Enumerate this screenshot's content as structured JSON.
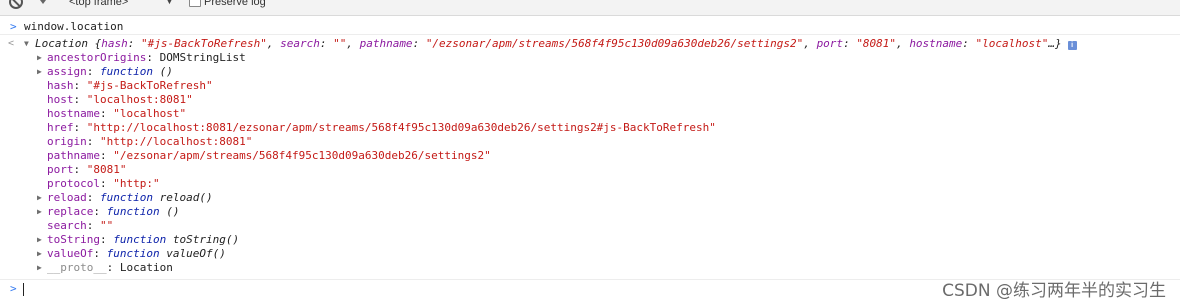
{
  "toolbar": {
    "clear_icon": "clear-console-icon",
    "filter_icon": "filter-icon",
    "context": "<top frame>",
    "context_caret": "▼",
    "preserve_log": "Preserve log"
  },
  "console": {
    "input_prompt": ">",
    "return_marker": "<",
    "command": "window.location",
    "result": {
      "class_name": "Location",
      "summary_open": " {",
      "summary": [
        {
          "key": "hash",
          "value": "\"#js-BackToRefresh\""
        },
        {
          "key": "search",
          "value": "\"\""
        },
        {
          "key": "pathname",
          "value": "\"/ezsonar/apm/streams/568f4f95c130d09a630deb26/settings2\""
        },
        {
          "key": "port",
          "value": "\"8081\""
        },
        {
          "key": "hostname",
          "value": "\"localhost\""
        }
      ],
      "summary_close": "…}",
      "info_icon": "i",
      "properties": [
        {
          "key": "ancestorOrigins",
          "value": "DOMStringList",
          "kind": "object",
          "expandable": true
        },
        {
          "key": "assign",
          "fn": "function",
          "value": " ()",
          "kind": "function",
          "expandable": true
        },
        {
          "key": "hash",
          "value": "\"#js-BackToRefresh\"",
          "kind": "string",
          "expandable": false
        },
        {
          "key": "host",
          "value": "\"localhost:8081\"",
          "kind": "string",
          "expandable": false
        },
        {
          "key": "hostname",
          "value": "\"localhost\"",
          "kind": "string",
          "expandable": false
        },
        {
          "key": "href",
          "value": "\"http://localhost:8081/ezsonar/apm/streams/568f4f95c130d09a630deb26/settings2#js-BackToRefresh\"",
          "kind": "string",
          "expandable": false
        },
        {
          "key": "origin",
          "value": "\"http://localhost:8081\"",
          "kind": "string",
          "expandable": false
        },
        {
          "key": "pathname",
          "value": "\"/ezsonar/apm/streams/568f4f95c130d09a630deb26/settings2\"",
          "kind": "string",
          "expandable": false
        },
        {
          "key": "port",
          "value": "\"8081\"",
          "kind": "string",
          "expandable": false
        },
        {
          "key": "protocol",
          "value": "\"http:\"",
          "kind": "string",
          "expandable": false
        },
        {
          "key": "reload",
          "fn": "function",
          "value": " reload()",
          "kind": "function",
          "expandable": true
        },
        {
          "key": "replace",
          "fn": "function",
          "value": " ()",
          "kind": "function",
          "expandable": true
        },
        {
          "key": "search",
          "value": "\"\"",
          "kind": "string",
          "expandable": false
        },
        {
          "key": "toString",
          "fn": "function",
          "value": " toString()",
          "kind": "function",
          "expandable": true
        },
        {
          "key": "valueOf",
          "fn": "function",
          "value": " valueOf()",
          "kind": "function",
          "expandable": true
        },
        {
          "key": "__proto__",
          "value": "Location",
          "kind": "proto",
          "expandable": true
        }
      ]
    },
    "prompt_input_value": ""
  },
  "watermark": "CSDN @练习两年半的实习生",
  "colors": {
    "prompt": "#367cf1",
    "key": "#8c1aa0",
    "string": "#c41a16",
    "function_keyword": "#0d22aa"
  }
}
